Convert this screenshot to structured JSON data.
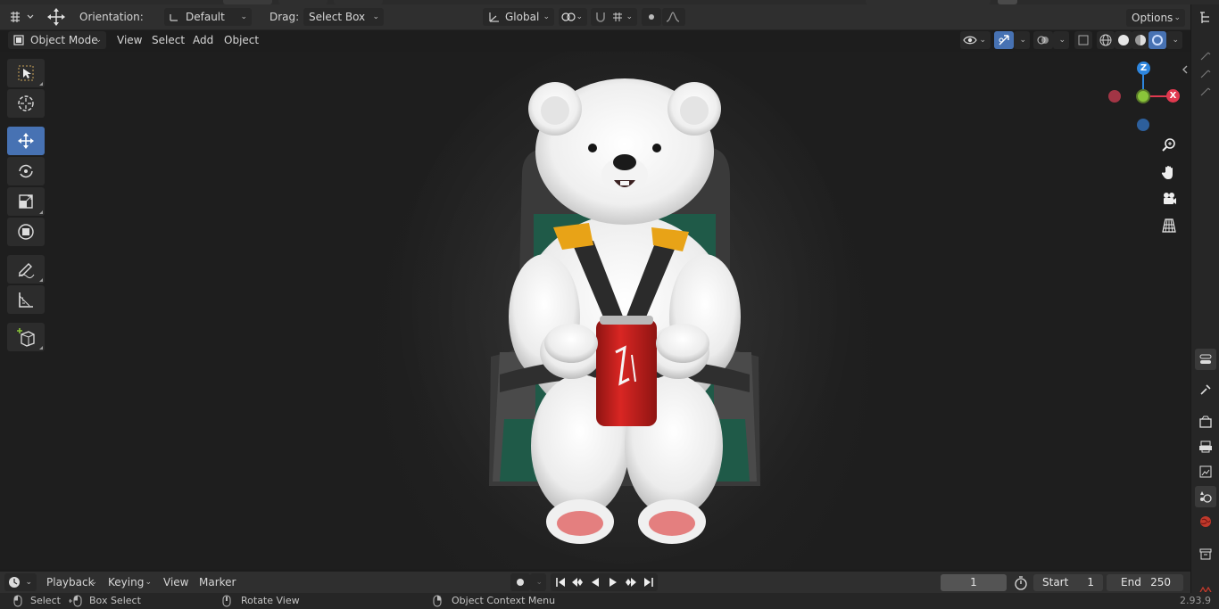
{
  "header": {
    "orientation_label": "Orientation:",
    "orientation_value": "Default",
    "drag_label": "Drag:",
    "drag_value": "Select Box",
    "transform_space": "Global",
    "options_label": "Options"
  },
  "view_header": {
    "mode": "Object Mode",
    "menus": [
      "View",
      "Select",
      "Add",
      "Object"
    ]
  },
  "toolbar": {
    "tools": [
      "select-box",
      "cursor",
      "move",
      "rotate",
      "scale",
      "transform",
      "annotate",
      "measure",
      "add-cube"
    ],
    "active_tool": "move"
  },
  "gizmo": {
    "z": "Z",
    "x": "X",
    "colors": {
      "x": "#e0394f",
      "y": "#8ac43a",
      "z": "#2e86de"
    }
  },
  "timeline": {
    "menus": [
      "Playback",
      "Keying",
      "View",
      "Marker"
    ],
    "current_frame": "1",
    "start_label": "Start",
    "start_value": "1",
    "end_label": "End",
    "end_value": "250"
  },
  "status": {
    "select": "Select",
    "box_select": "Box Select",
    "rotate_view": "Rotate View",
    "context_menu": "Object Context Menu",
    "version": "2.93.9"
  },
  "colors": {
    "accent": "#4772b3",
    "background": "#1d1d1d",
    "header": "#2f2f2f",
    "can_red": "#c8201e",
    "strap_yellow": "#e8a317"
  }
}
